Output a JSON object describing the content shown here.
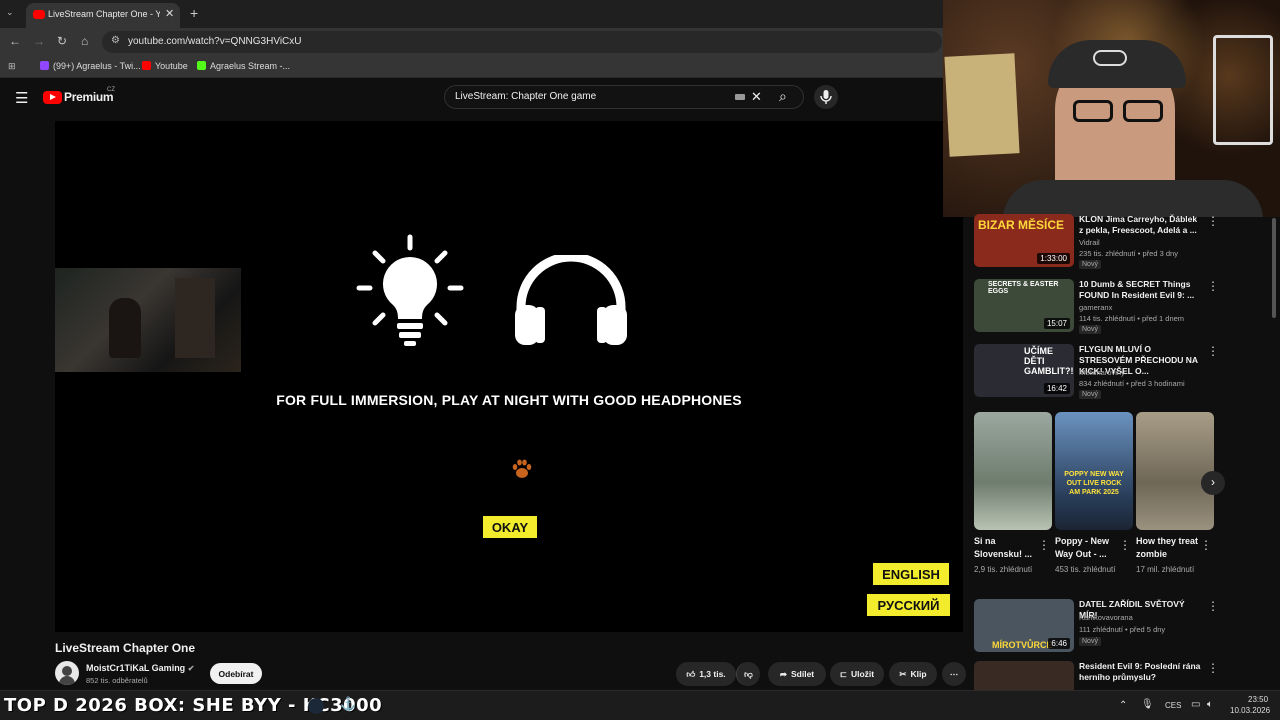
{
  "browser": {
    "tab_title": "LiveStream Chapter One - YouT",
    "url": "youtube.com/watch?v=QNNG3HViCxU",
    "bookmarks": [
      {
        "label": "(99+) Agraelus - Twi...",
        "color": "#9146ff"
      },
      {
        "label": "Youtube",
        "color": "#ff0000"
      },
      {
        "label": "Agraelus Stream -...",
        "color": "#53fc18"
      }
    ]
  },
  "youtube": {
    "logo_text": "Premium",
    "region": "CZ",
    "search_query": "LiveStream: Chapter One game"
  },
  "player": {
    "message": "FOR FULL IMMERSION, PLAY AT NIGHT WITH GOOD HEADPHONES",
    "okay_label": "OKAY",
    "english_label": "ENGLISH",
    "russian_label": "РУССКИЙ",
    "accent": "#f2ec2c",
    "paw_color": "#c8641e"
  },
  "video": {
    "title": "LiveStream Chapter One",
    "channel": "MoistCr1TiKaL Gaming",
    "subscribers": "852 tis. odběratelů",
    "subscribe_label": "Odebírat",
    "likes": "1,3 tis.",
    "share_label": "Sdílet",
    "save_label": "Uložit",
    "clip_label": "Klip"
  },
  "recommended": [
    {
      "title": "KLON Jima Carreyho, Ďáblek z pekla, Freescoot, Adelá a ...",
      "channel": "Vidrail",
      "meta": "235 tis. zhlédnutí • před 3 dny",
      "badge": "Nový",
      "duration": "1:33:00",
      "thumb_text": "BIZAR MĚSÍCE",
      "thumb_color": "#8a2a1c"
    },
    {
      "title": "10 Dumb & SECRET Things FOUND In Resident Evil 9: ...",
      "channel": "gameranx",
      "meta": "114 tis. zhlédnutí • před 1 dnem",
      "badge": "Nový",
      "duration": "15:07",
      "thumb_text": "SECRETS & EASTER EGGS",
      "thumb_color": "#3d4a3a"
    },
    {
      "title": "FLYGUN MLUVÍ O STRESOVÉM PŘECHODU NA KICK! VYŠEL O...",
      "channel": "Melicharoviny",
      "meta": "834 zhlédnutí • před 3 hodinami",
      "badge": "Nový",
      "duration": "16:42",
      "thumb_text": "UČÍME DĚTI GAMBLIT?!",
      "thumb_color": "#2b2b33"
    },
    {
      "title": "DATEL ZAŘÍDIL SVĚTOVÝ MÍR!",
      "channel": "Karlikovavorana",
      "meta": "111 zhlédnutí • před 5 dny",
      "badge": "Nový",
      "duration": "6:46",
      "thumb_text": "MÍROTVŮRCE",
      "thumb_color": "#4a5560"
    },
    {
      "title": "Resident Evil 9: Poslední rána herního průmyslu?",
      "channel": "",
      "meta": "",
      "badge": "",
      "duration": "",
      "thumb_text": "",
      "thumb_color": "#3a2a24"
    }
  ],
  "shorts": [
    {
      "title": "Si na Slovensku! ...",
      "views": "2,9 tis. zhlédnutí",
      "color": "#7a8a7a"
    },
    {
      "title": "Poppy - New Way Out - ...",
      "views": "453 tis. zhlédnutí",
      "color": "#5a7fa6",
      "overlay": "POPPY NEW WAY OUT LIVE ROCK AM PARK 2025"
    },
    {
      "title": "How they treat zombie",
      "views": "17 mil. zhlédnutí",
      "color": "#8c8270"
    }
  ],
  "taskbar": {
    "ticker": "TOP D 2026 BOX: SHE  BYY - KC3000",
    "language": "CES",
    "time": "23:50",
    "date": "10.03.2026"
  }
}
